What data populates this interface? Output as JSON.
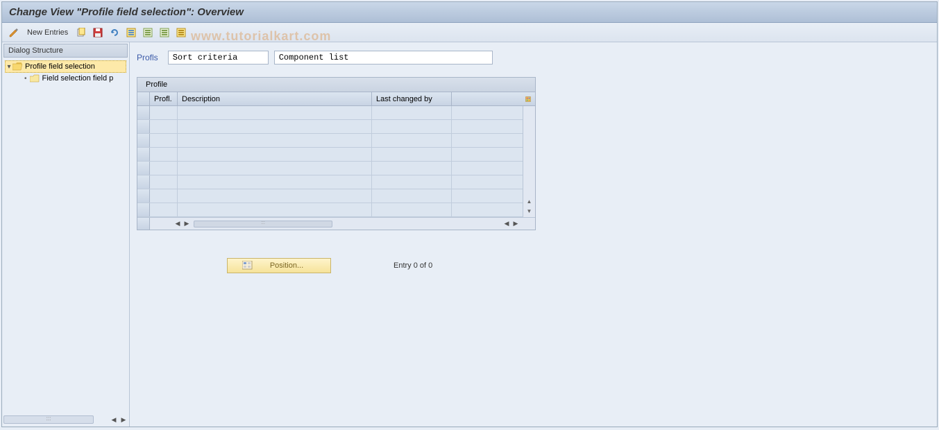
{
  "title": "Change View \"Profile field selection\": Overview",
  "watermark": "www.tutorialkart.com",
  "toolbar": {
    "new_entries": "New Entries"
  },
  "sidebar": {
    "header": "Dialog Structure",
    "items": [
      {
        "label": "Profile field selection",
        "selected": true,
        "open": true
      },
      {
        "label": "Field selection field p",
        "selected": false,
        "open": false
      }
    ]
  },
  "top_fields": {
    "label": "Profls",
    "value1": "Sort criteria",
    "value2": "Component list"
  },
  "table": {
    "title": "Profile",
    "columns": {
      "profl": "Profl.",
      "description": "Description",
      "last_changed": "Last changed by"
    }
  },
  "position_button": "Position...",
  "entry_status": "Entry 0 of 0"
}
